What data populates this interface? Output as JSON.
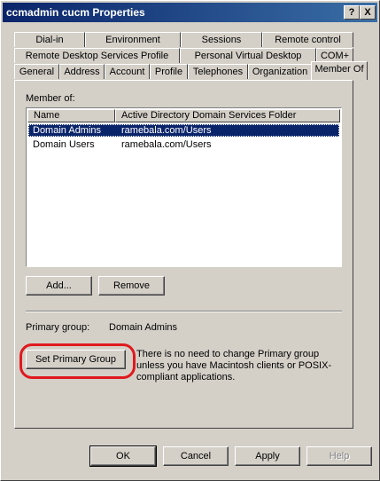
{
  "window": {
    "title": "ccmadmin cucm Properties",
    "help_button": "?",
    "close_button": "X"
  },
  "tabs_row1": [
    {
      "label": "Dial-in"
    },
    {
      "label": "Environment"
    },
    {
      "label": "Sessions"
    },
    {
      "label": "Remote control"
    }
  ],
  "tabs_row2": [
    {
      "label": "Remote Desktop Services Profile"
    },
    {
      "label": "Personal Virtual Desktop"
    },
    {
      "label": "COM+"
    }
  ],
  "tabs_row3": [
    {
      "label": "General"
    },
    {
      "label": "Address"
    },
    {
      "label": "Account"
    },
    {
      "label": "Profile"
    },
    {
      "label": "Telephones"
    },
    {
      "label": "Organization"
    },
    {
      "label": "Member Of"
    }
  ],
  "member_of": {
    "label": "Member of:",
    "columns": [
      "Name",
      "Active Directory Domain Services Folder"
    ],
    "rows": [
      {
        "name": "Domain Admins",
        "folder": "ramebala.com/Users",
        "selected": true
      },
      {
        "name": "Domain Users",
        "folder": "ramebala.com/Users",
        "selected": false
      }
    ],
    "add_button": "Add...",
    "remove_button": "Remove"
  },
  "primary_group": {
    "label": "Primary group:",
    "value": "Domain Admins",
    "set_button": "Set Primary Group",
    "info": "There is no need to change Primary group unless you have Macintosh clients or POSIX-compliant applications."
  },
  "footer": {
    "ok": "OK",
    "cancel": "Cancel",
    "apply": "Apply",
    "help": "Help"
  },
  "colors": {
    "titlebar": "#0a246a",
    "selection": "#0a246a",
    "highlight_circle": "#e0191e",
    "face": "#d4d0c8"
  }
}
